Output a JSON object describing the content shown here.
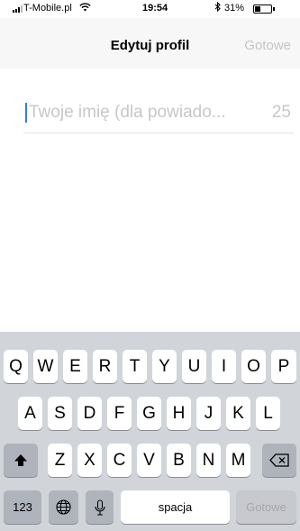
{
  "status_bar": {
    "carrier": "T-Mobile.pl",
    "time": "19:54",
    "battery": "31%",
    "icons": [
      "signal-icon",
      "wifi-icon",
      "bluetooth-icon",
      "battery-icon"
    ]
  },
  "nav": {
    "title": "Edytuj profil",
    "done_label": "Gotowe",
    "done_color": "#c4c4c4"
  },
  "field": {
    "placeholder": "Twoje imię (dla powiado...",
    "value": "",
    "counter": "25",
    "caret_color": "#2f7cf6"
  },
  "keyboard": {
    "row1": [
      "Q",
      "W",
      "E",
      "R",
      "T",
      "Y",
      "U",
      "I",
      "O",
      "P"
    ],
    "row2": [
      "A",
      "S",
      "D",
      "F",
      "G",
      "H",
      "J",
      "K",
      "L"
    ],
    "row3": [
      "Z",
      "X",
      "C",
      "V",
      "B",
      "N",
      "M"
    ],
    "numbers_label": "123",
    "space_label": "spacja",
    "return_label": "Gotowe",
    "icons": [
      "shift-icon",
      "backspace-icon",
      "globe-icon",
      "microphone-icon"
    ]
  }
}
